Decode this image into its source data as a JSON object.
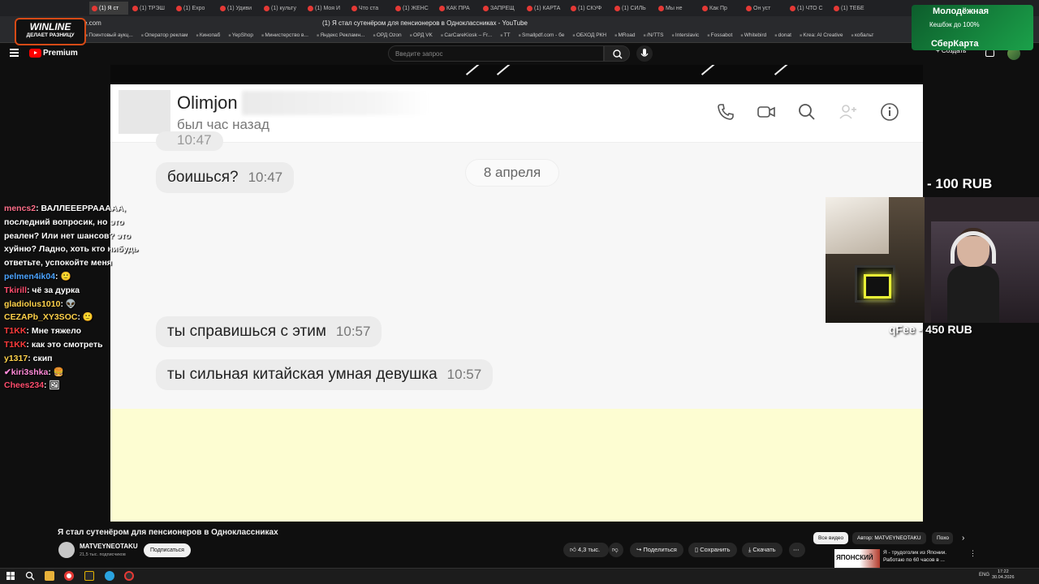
{
  "browser": {
    "tabs": [
      "(1) Я ст",
      "(1) ТРЭШ",
      "(1) Expo",
      "(1) Удиви",
      "(1) культу",
      "(1) Моя И",
      "Что ста",
      "(1) ЖЕНС",
      "КАК ПРА",
      "ЗАПРЕЩ",
      "(1) КАРТА",
      "(1) СКУФ",
      "(1) СИЛЬ",
      "Мы не",
      "Как Пр",
      "Он уст",
      "(1) ЧТО С",
      "(1) ТЕБЕ"
    ],
    "url_fragment": "e.com",
    "page_title": "(1) Я стал сутенёром для пенсионеров в Одноклассниках - YouTube",
    "bookmarks": [
      "Поинтовый аукц...",
      "Оператор реклам",
      "Кинопаб",
      "YepShop",
      "Министерство в...",
      "Яндекс Рекламн...",
      "ОРД Ozon",
      "ОРД VK",
      "CarCareKiosk – Fr...",
      "TT",
      "Smallpdf.com - бе",
      "ОБХОД РКН",
      "MRoad",
      "/N/TTS",
      "Interslavic",
      "Fossabot",
      "Whitebird",
      "donat",
      "Krea: AI Creative",
      "кобальт"
    ]
  },
  "ads": {
    "winline_brand": "WINLINE",
    "winline_slogan": "ДЕЛАЕТ РАЗНИЦУ",
    "sber_line1": "Молодёжная",
    "sber_line2": "Кешбэк до 100%",
    "sber_line3": "СберКарта"
  },
  "youtube": {
    "premium_label": "Premium",
    "search_placeholder": "Введите запрос",
    "create_label": "+ Создать",
    "video_title": "Я стал сутенёром для пенсионеров в Одноклассниках",
    "channel_name": "MATVEYNEOTAKU",
    "subscribers": "21,5 тыс. подписчиков",
    "subscribe_label": "Подписаться",
    "likes": "4,3 тыс.",
    "share_label": "Поделиться",
    "save_label": "Сохранить",
    "download_label": "Скачать",
    "chips": [
      "Все видео",
      "Автор: MATVEYNEOTAKU",
      "Похо"
    ],
    "rec_thumb_text": "ЯПОНСКИЙ",
    "rec_title": "Я - трудоголик из Японии. Работаю по 60 часов в ..."
  },
  "chat_ui": {
    "contact_name": "Olimjon",
    "contact_status": "был час назад",
    "date_separator": "8 апреля",
    "messages": [
      {
        "text": "боишься?",
        "time": "10:47"
      },
      {
        "text": "ты справишься с этим",
        "time": "10:57"
      },
      {
        "text": "ты сильная китайская умная девушка",
        "time": "10:57"
      }
    ],
    "partial_time_top": "10:47"
  },
  "stream_chat": [
    {
      "user": "mencs2",
      "color": "#ff6f8a",
      "text": "ВАЛЛЕЕЕРРААААА, последний вопросик, но это реален? Или нет шансов? это хуйню? Ладно, хоть кто нибудь ответьте, успокойте меня"
    },
    {
      "user": "pelmen4ik04",
      "color": "#4aa3ff",
      "text": "🙂"
    },
    {
      "user": "Tkirill",
      "color": "#ff4d6d",
      "text": "чё за дурка"
    },
    {
      "user": "gladiolus1010",
      "color": "#ffd24a",
      "text": "👽"
    },
    {
      "user": "CEZAPb_XY3SOC",
      "color": "#ffd24a",
      "text": "🙂"
    },
    {
      "user": "T1KK",
      "color": "#ff3b3b",
      "text": "Мне тяжело"
    },
    {
      "user": "T1KK",
      "color": "#ff3b3b",
      "text": "как это смотреть"
    },
    {
      "user": "y1317",
      "color": "#ffd24a",
      "text": "скип"
    },
    {
      "user": "✔kiri3shka",
      "color": "#ff8ad8",
      "text": "🍔"
    },
    {
      "user": "Chees234",
      "color": "#ff4d6d",
      "text": "🖼"
    }
  ],
  "donations": [
    {
      "text": "- 100 RUB"
    },
    {
      "text": "qFee - 450 RUB"
    }
  ],
  "taskbar": {
    "lang": "ENG",
    "time": "17:22",
    "date": "30.04.2026"
  }
}
